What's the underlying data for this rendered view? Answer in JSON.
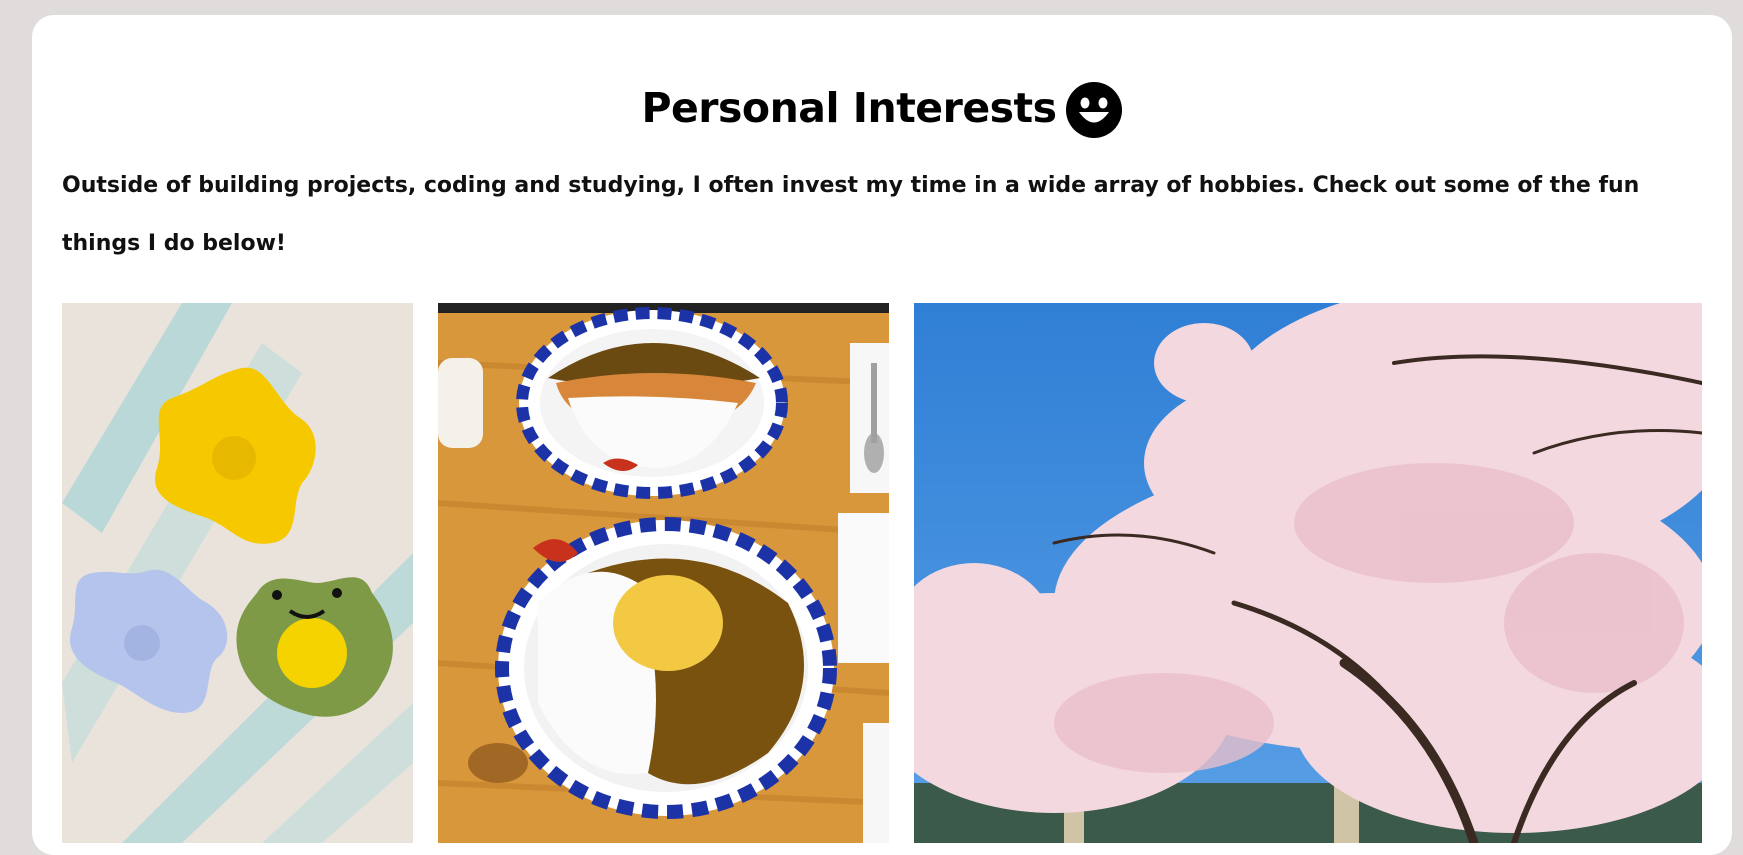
{
  "section": {
    "title": "Personal Interests",
    "title_icon": "smiley-face-icon",
    "intro": "Outside of building projects, coding and studying, I often invest my time in a wide array of hobbies. Check out some of the fun things I do below!"
  },
  "gallery": {
    "photos": [
      {
        "subject": "crochet-coasters",
        "icon": "crochet-photo"
      },
      {
        "subject": "curry-plates",
        "icon": "curry-photo"
      },
      {
        "subject": "cherry-blossoms",
        "icon": "cherry-blossom-photo"
      }
    ]
  },
  "colors": {
    "page_bg": "#e0dcdc",
    "card_bg": "#ffffff",
    "text": "#000000",
    "sky": "#2f7fd6",
    "blossom": "#f4d8df",
    "crochet_yellow": "#f5c800",
    "crochet_blue": "#b4c4ec",
    "crochet_green": "#7f9a46",
    "table_wood": "#d9973b",
    "plate_blue": "#1c33a8",
    "curry": "#7a5210"
  }
}
